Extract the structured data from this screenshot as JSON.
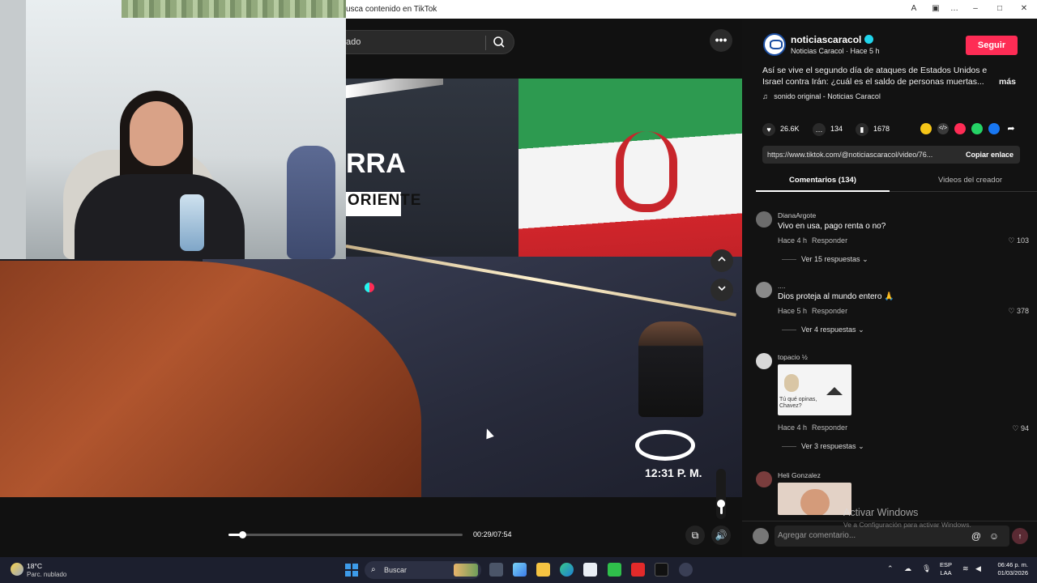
{
  "browser": {
    "title": "usca contenido en TikTok"
  },
  "player": {
    "search_placeholder": "ado",
    "more_label": "•••",
    "headline_top": "RRA",
    "headline_bottom": "ORIENTE",
    "clock": "12:31 P. M.",
    "time": "00:29/07:54",
    "progress": 0.06,
    "volume": 0.25
  },
  "post": {
    "author_handle": "noticiascaracol",
    "author_display": "Noticias Caracol · Hace 5 h",
    "follow_label": "Seguir",
    "description_line1": "Así se vive el segundo día de ataques de Estados Unidos e",
    "description_line2": "Israel contra Irán: ¿cuál es el saldo de personas muertas...",
    "more_label": "más",
    "sound": "sonido original - Noticias Caracol",
    "likes": "26.6K",
    "comments": "134",
    "saves": "1678",
    "link": "https://www.tiktok.com/@noticiascaracol/video/76...",
    "copy_label": "Copiar enlace",
    "tab_comments": "Comentarios (134)",
    "tab_videos": "Videos del creador"
  },
  "comments": [
    {
      "user": "DianaArgote",
      "text": "Vivo en usa, pago renta o no?",
      "time": "Hace 4 h",
      "reply": "Responder",
      "likes": "103",
      "more": "Ver 15 respuestas"
    },
    {
      "user": "....",
      "text": "Dios proteja al mundo entero 🙏",
      "time": "Hace 5 h",
      "reply": "Responder",
      "likes": "378",
      "more": "Ver 4 respuestas"
    },
    {
      "user": "topacio ½",
      "text": "",
      "image_caption": "Tú qué opinas, Chavez?",
      "time": "Hace 4 h",
      "reply": "Responder",
      "likes": "94",
      "more": "Ver 3 respuestas"
    },
    {
      "user": "Heli Gonzalez",
      "text": ""
    }
  ],
  "comment_box": {
    "placeholder": "Agregar comentario..."
  },
  "watermark": {
    "title": "Activar Windows",
    "subtitle": "Ve a Configuración para activar Windows."
  },
  "taskbar": {
    "temp": "18°C",
    "weather": "Parc. nublado",
    "search": "Buscar",
    "lang_top": "ESP",
    "lang_bottom": "LAA",
    "time": "06:46 p. m.",
    "date": "01/03/2026"
  },
  "colors": {
    "follow": "#fe2c55",
    "verified": "#20d5ec"
  }
}
